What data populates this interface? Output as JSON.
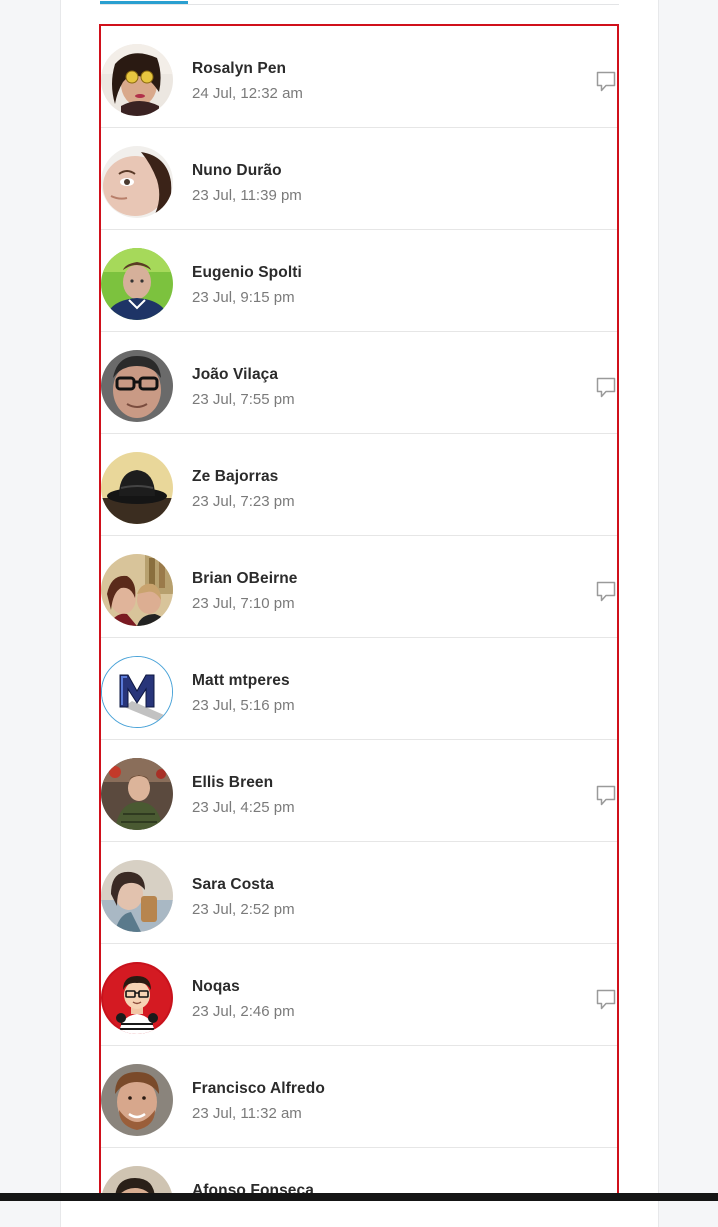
{
  "colors": {
    "accent_tab": "#2a9fd0",
    "selection_border": "#d0101b",
    "name_text": "#2b2b2b",
    "time_text": "#7a7a7a"
  },
  "people": [
    {
      "name": "Rosalyn Pen",
      "time": "24 Jul, 12:32 am",
      "has_comment": true
    },
    {
      "name": "Nuno Durão",
      "time": "23 Jul, 11:39 pm",
      "has_comment": false
    },
    {
      "name": "Eugenio Spolti",
      "time": "23 Jul, 9:15 pm",
      "has_comment": false
    },
    {
      "name": "João Vilaça",
      "time": "23 Jul, 7:55 pm",
      "has_comment": true
    },
    {
      "name": "Ze Bajorras",
      "time": "23 Jul, 7:23 pm",
      "has_comment": false
    },
    {
      "name": "Brian OBeirne",
      "time": "23 Jul, 7:10 pm",
      "has_comment": true
    },
    {
      "name": "Matt mtperes",
      "time": "23 Jul, 5:16 pm",
      "has_comment": false
    },
    {
      "name": "Ellis Breen",
      "time": "23 Jul, 4:25 pm",
      "has_comment": true
    },
    {
      "name": "Sara Costa",
      "time": "23 Jul, 2:52 pm",
      "has_comment": false
    },
    {
      "name": "Noqas",
      "time": "23 Jul, 2:46 pm",
      "has_comment": true
    },
    {
      "name": "Francisco Alfredo",
      "time": "23 Jul, 11:32 am",
      "has_comment": false
    },
    {
      "name": "Afonso Fonseca",
      "time": "",
      "has_comment": false
    }
  ],
  "icons": {
    "comment": "comment-bubble-icon"
  }
}
